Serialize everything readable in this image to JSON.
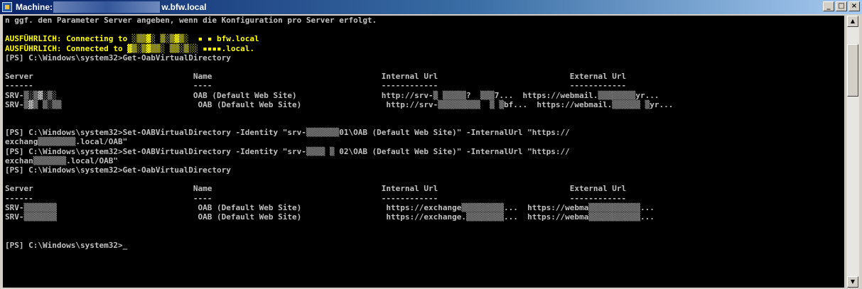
{
  "window": {
    "title": "Machine: ",
    "title_suffix": "w.bfw.local",
    "minimize_glyph": "_",
    "maximize_glyph": "□",
    "close_glyph": "×"
  },
  "console": {
    "colors": {
      "background": "#000000",
      "text": "#c0c0c0",
      "verbose": "#ffff00"
    },
    "lines": [
      {
        "text": "n ggf. den Parameter Server angeben, wenn die Konfiguration pro Server erfolgt.",
        "color": "gray"
      },
      {
        "text": "",
        "color": "gray"
      },
      {
        "text": "AUSFÜHRLICH: Connecting to ░▒▒▓░ ▒░▒▓▒░  ▪ ▪ bfw.local",
        "color": "yellow"
      },
      {
        "text": "AUSFÜHRLICH: Connected to ▓▒░▒▓▒▒░ ▒▒░▒░░ ▪▪▪▪.local.",
        "color": "yellow"
      },
      {
        "text": "[PS] C:\\Windows\\system32>Get-OabVirtualDirectory",
        "color": "gray"
      },
      {
        "text": "",
        "color": "gray"
      },
      {
        "text": "Server                                  Name                                    Internal Url                            External Url",
        "color": "gray"
      },
      {
        "text": "------                                  ----                                    ------------                            ------------",
        "color": "gray"
      },
      {
        "text": "SRV-▒░▒▓░▒░                             OAB (Default Web Site)                  http://srv-▒ ▒▒▒▒▒?  ▒▒▒7...  https://webmail.▒▒▒▒▒▒▒▒yr...",
        "color": "gray"
      },
      {
        "text": "SRV-▒▓▒ ▒░▒▒                             OAB (Default Web Site)                  http://srv-▒▒▒▒▒▒▒▒▒  ▒ ▒bf...  https://webmail.▒▒▒▒▒▒ ▒yr...",
        "color": "gray"
      },
      {
        "text": "",
        "color": "gray"
      },
      {
        "text": "",
        "color": "gray"
      },
      {
        "text": "[PS] C:\\Windows\\system32>Set-OABVirtualDirectory -Identity \"srv-▒▒▒▒▒▒▒01\\OAB (Default Web Site)\" -InternalUrl \"https://",
        "color": "gray"
      },
      {
        "text": "exchang▒▒▒▒▒▒▒▒.local/OAB\"",
        "color": "gray"
      },
      {
        "text": "[PS] C:\\Windows\\system32>Set-OABVirtualDirectory -Identity \"srv-▒▒▒▒ ▒ 02\\OAB (Default Web Site)\" -InternalUrl \"https://",
        "color": "gray"
      },
      {
        "text": "exchan▒▒▒▒▒▒▒.local/OAB\"",
        "color": "gray"
      },
      {
        "text": "[PS] C:\\Windows\\system32>Get-OabVirtualDirectory",
        "color": "gray"
      },
      {
        "text": "",
        "color": "gray"
      },
      {
        "text": "Server                                  Name                                    Internal Url                            External Url",
        "color": "gray"
      },
      {
        "text": "------                                  ----                                    ------------                            ------------",
        "color": "gray"
      },
      {
        "text": "SRV-▒▒▒▒▒▒▒                              OAB (Default Web Site)                  https://exchange▒▒▒▒▒▒▒▒▒...  https://webma▒▒▒▒▒▒▒▒▒▒▒...",
        "color": "gray"
      },
      {
        "text": "SRV-▒▒▒▒▒▒▒                              OAB (Default Web Site)                  https://exchange.▒▒▒▒▒▒▒▒...  https://webma▒▒▒▒▒▒▒▒▒▒▒...",
        "color": "gray"
      },
      {
        "text": "",
        "color": "gray"
      },
      {
        "text": "",
        "color": "gray"
      },
      {
        "text": "[PS] C:\\Windows\\system32>",
        "color": "gray"
      }
    ],
    "cursor": "_"
  }
}
